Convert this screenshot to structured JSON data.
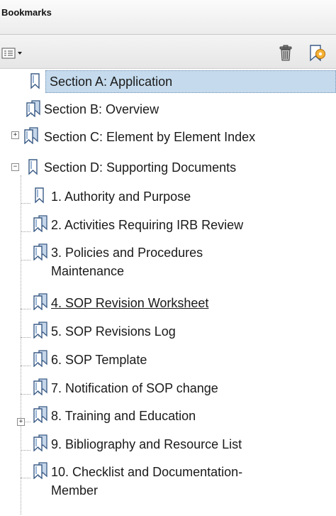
{
  "panel": {
    "title": "Bookmarks"
  },
  "toolbar": {
    "options_icon": "options-menu-icon",
    "delete_icon": "trash-icon",
    "properties_icon": "bookmark-properties-icon"
  },
  "bookmarks": {
    "section_a": "Section A: Application",
    "section_b": "Section B:  Overview",
    "section_c": "Section C: Element by Element Index",
    "section_d": "Section D: Supporting Documents",
    "children": [
      "1. Authority and Purpose",
      "2. Activities Requiring IRB Review",
      "3. Policies and Procedures",
      "Maintenance",
      "4. SOP Revision Worksheet",
      "5. SOP Revisions Log",
      "6. SOP Template",
      "7. Notification of SOP change",
      "8. Training and Education",
      "9. Bibliography and Resource List",
      "10. Checklist and Documentation-",
      "Member"
    ]
  },
  "colors": {
    "selection": "#c5dbed",
    "header": "#ececec"
  }
}
